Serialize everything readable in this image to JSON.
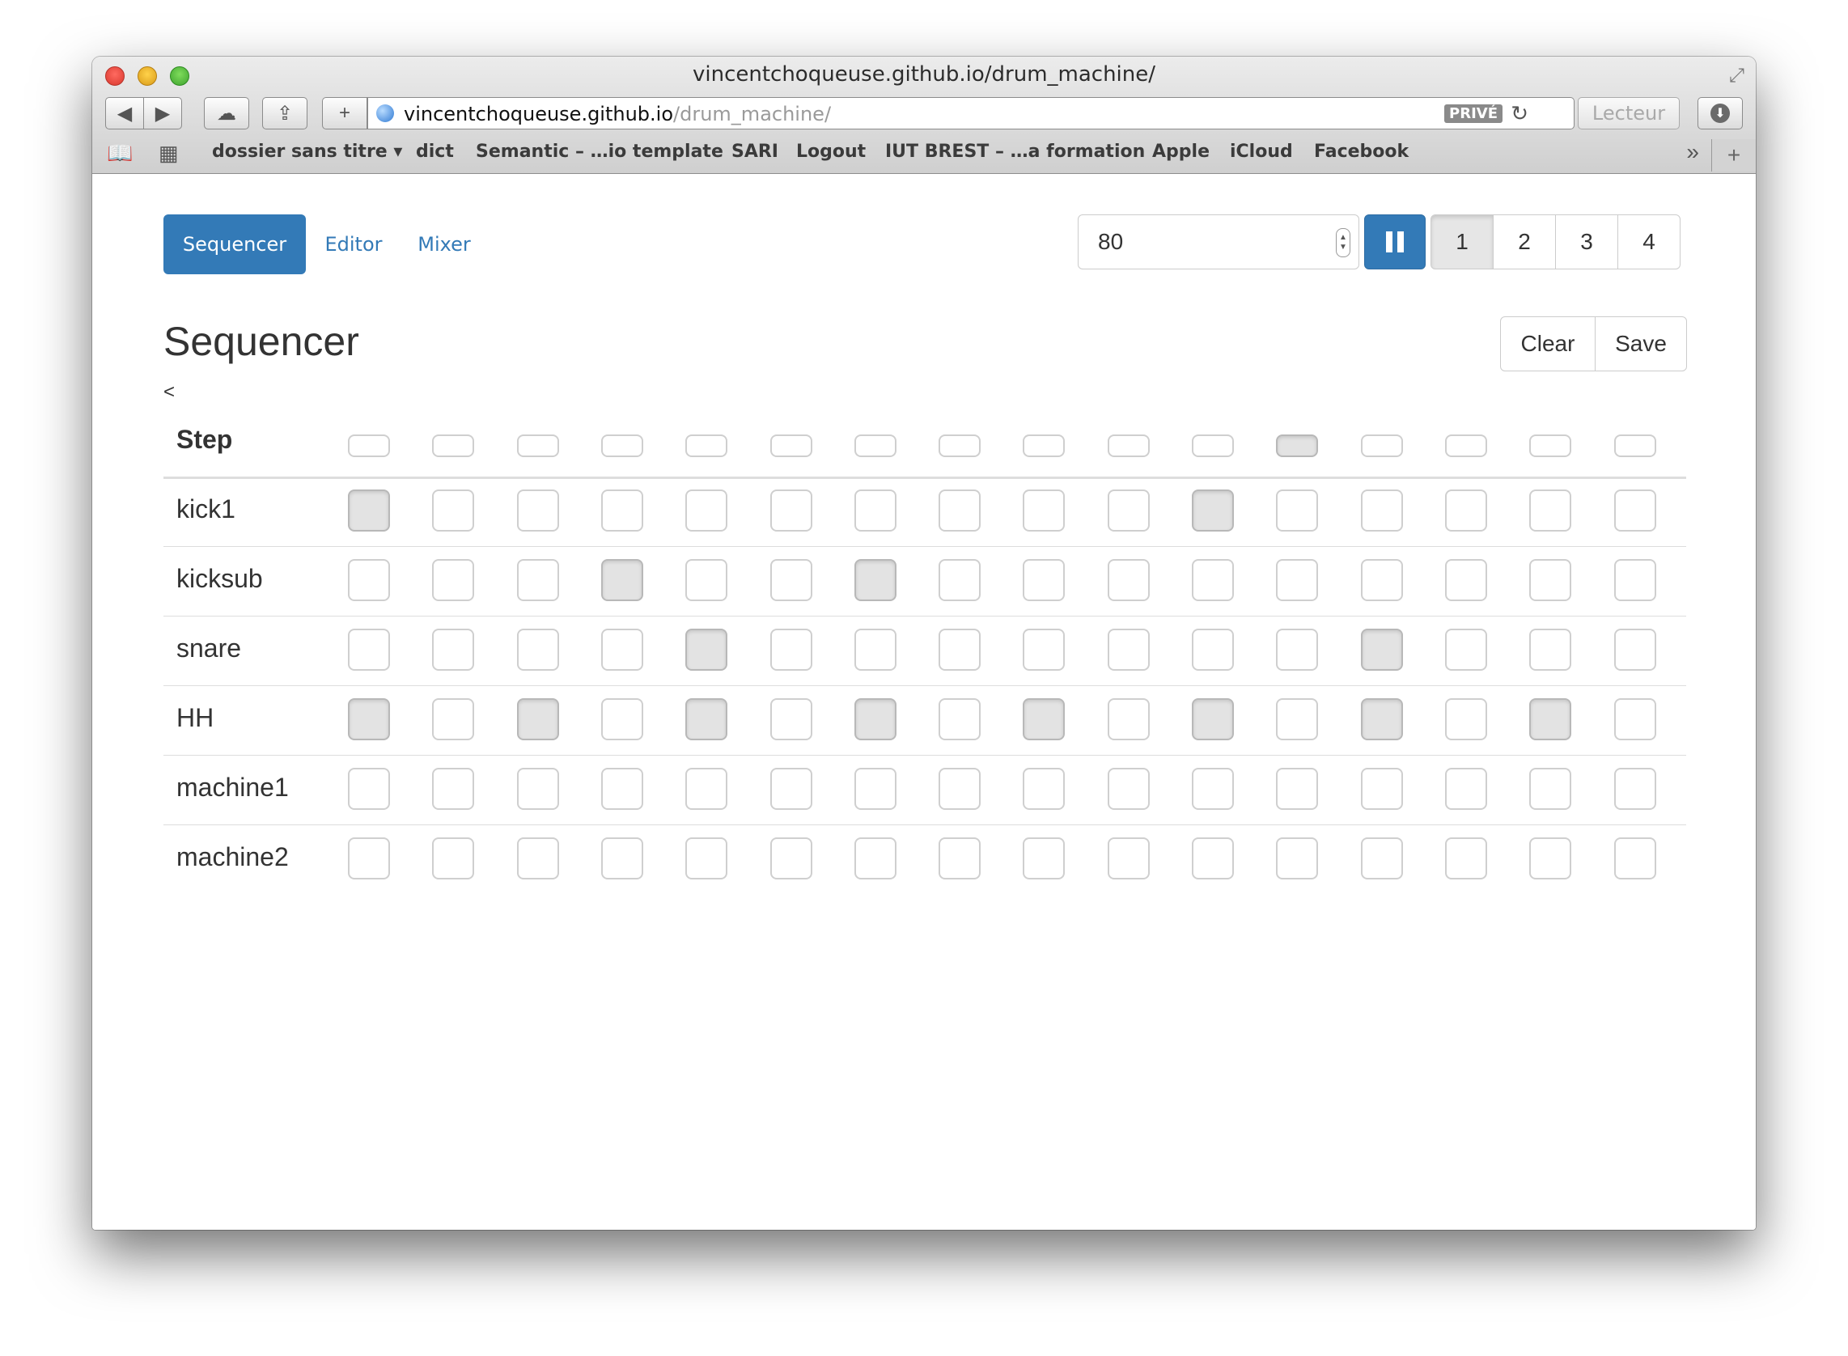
{
  "browser": {
    "window_title": "vincentchoqueuse.github.io/drum_machine/",
    "url_host": "vincentchoqueuse.github.io",
    "url_path": "/drum_machine/",
    "private_badge": "PRIVÉ",
    "reader_label": "Lecteur",
    "bookmarks": [
      "dossier sans titre ▾",
      "dict",
      "Semantic – …io template",
      "SARI",
      "Logout",
      "IUT BREST – …a formation",
      "Apple",
      "iCloud",
      "Facebook"
    ]
  },
  "nav": {
    "tabs": [
      {
        "label": "Sequencer",
        "active": true
      },
      {
        "label": "Editor",
        "active": false
      },
      {
        "label": "Mixer",
        "active": false
      }
    ]
  },
  "controls": {
    "tempo": "80",
    "playing": true,
    "patterns": [
      {
        "label": "1",
        "active": true
      },
      {
        "label": "2",
        "active": false
      },
      {
        "label": "3",
        "active": false
      },
      {
        "label": "4",
        "active": false
      }
    ]
  },
  "sequencer": {
    "title": "Sequencer",
    "back_link": "<",
    "clear_label": "Clear",
    "save_label": "Save",
    "step_label": "Step",
    "current_step": 12,
    "num_steps": 16,
    "tracks": [
      {
        "name": "kick1",
        "steps": [
          1,
          0,
          0,
          0,
          0,
          0,
          0,
          0,
          0,
          0,
          1,
          0,
          0,
          0,
          0,
          0
        ]
      },
      {
        "name": "kicksub",
        "steps": [
          0,
          0,
          0,
          1,
          0,
          0,
          1,
          0,
          0,
          0,
          0,
          0,
          0,
          0,
          0,
          0
        ]
      },
      {
        "name": "snare",
        "steps": [
          0,
          0,
          0,
          0,
          1,
          0,
          0,
          0,
          0,
          0,
          0,
          0,
          1,
          0,
          0,
          0
        ]
      },
      {
        "name": "HH",
        "steps": [
          1,
          0,
          1,
          0,
          1,
          0,
          1,
          0,
          1,
          0,
          1,
          0,
          1,
          0,
          1,
          0
        ]
      },
      {
        "name": "machine1",
        "steps": [
          0,
          0,
          0,
          0,
          0,
          0,
          0,
          0,
          0,
          0,
          0,
          0,
          0,
          0,
          0,
          0
        ]
      },
      {
        "name": "machine2",
        "steps": [
          0,
          0,
          0,
          0,
          0,
          0,
          0,
          0,
          0,
          0,
          0,
          0,
          0,
          0,
          0,
          0
        ]
      }
    ]
  }
}
